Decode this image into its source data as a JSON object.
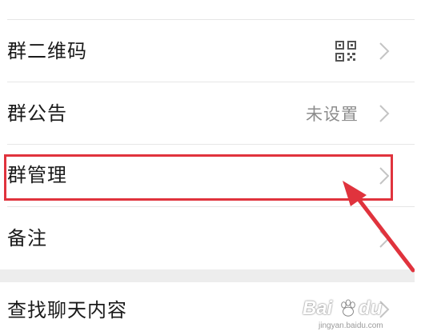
{
  "rows": {
    "qr_code": {
      "label": "群二维码",
      "icon": "qr-code-icon"
    },
    "announcement": {
      "label": "群公告",
      "value": "未设置"
    },
    "manage": {
      "label": "群管理"
    },
    "remark": {
      "label": "备注"
    },
    "search_history": {
      "label": "查找聊天内容"
    }
  },
  "annotation": {
    "box_color": "#e0333d",
    "arrow_color": "#e0333d"
  },
  "watermark": {
    "brand": "Bai",
    "brand_tail": "du",
    "subtitle": "jingyan.baidu.com",
    "logo": "baidu-paw-logo"
  },
  "colors": {
    "text": "#1a1a1a",
    "secondary_text": "#8c8c8c",
    "divider": "#e6e6e6",
    "section_gap": "#ededed",
    "chevron": "#c4c4c4"
  }
}
